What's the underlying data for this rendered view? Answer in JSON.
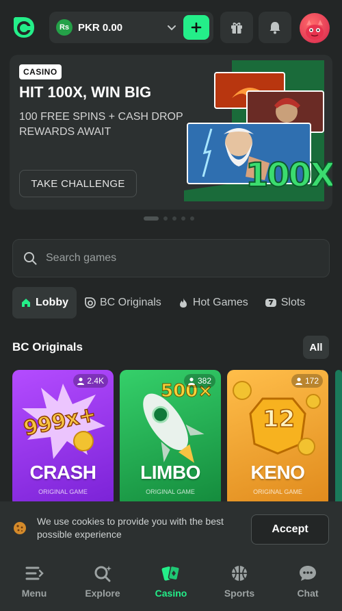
{
  "header": {
    "currency_code": "Rs",
    "balance": "PKR 0.00"
  },
  "banner": {
    "badge": "CASINO",
    "title": "HIT 100X, WIN BIG",
    "subtitle": "100 FREE SPINS + CASH DROP REWARDS AWAIT",
    "button": "TAKE CHALLENGE",
    "art_text": "100X",
    "slides_total": 5,
    "active_slide": 1
  },
  "search": {
    "placeholder": "Search games"
  },
  "tabs": [
    {
      "label": "Lobby",
      "icon": "home-icon"
    },
    {
      "label": "BC Originals",
      "icon": "bc-logo-icon"
    },
    {
      "label": "Hot Games",
      "icon": "flame-icon"
    },
    {
      "label": "Slots",
      "icon": "slot-machine-icon"
    }
  ],
  "originals": {
    "title": "BC Originals",
    "all_label": "All",
    "games": [
      {
        "name": "CRASH",
        "tag": "ORIGINAL GAME",
        "players": "2.4K",
        "art_text": "999x+"
      },
      {
        "name": "LIMBO",
        "tag": "ORIGINAL GAME",
        "players": "382",
        "art_text": "500×"
      },
      {
        "name": "KENO",
        "tag": "ORIGINAL GAME",
        "players": "172",
        "art_text": "12"
      }
    ]
  },
  "cookie": {
    "text": "We use cookies to provide you with the best possible experience",
    "accept": "Accept"
  },
  "bottom_nav": [
    {
      "label": "Menu",
      "icon": "menu-icon"
    },
    {
      "label": "Explore",
      "icon": "explore-search-icon"
    },
    {
      "label": "Casino",
      "icon": "cards-icon"
    },
    {
      "label": "Sports",
      "icon": "basketball-icon"
    },
    {
      "label": "Chat",
      "icon": "chat-icon"
    }
  ],
  "colors": {
    "accent": "#24ee89",
    "background": "#232626",
    "panel": "#2c3030",
    "crash": "#9b3ee8",
    "limbo": "#1fa84c",
    "keno": "#f0a02a"
  }
}
